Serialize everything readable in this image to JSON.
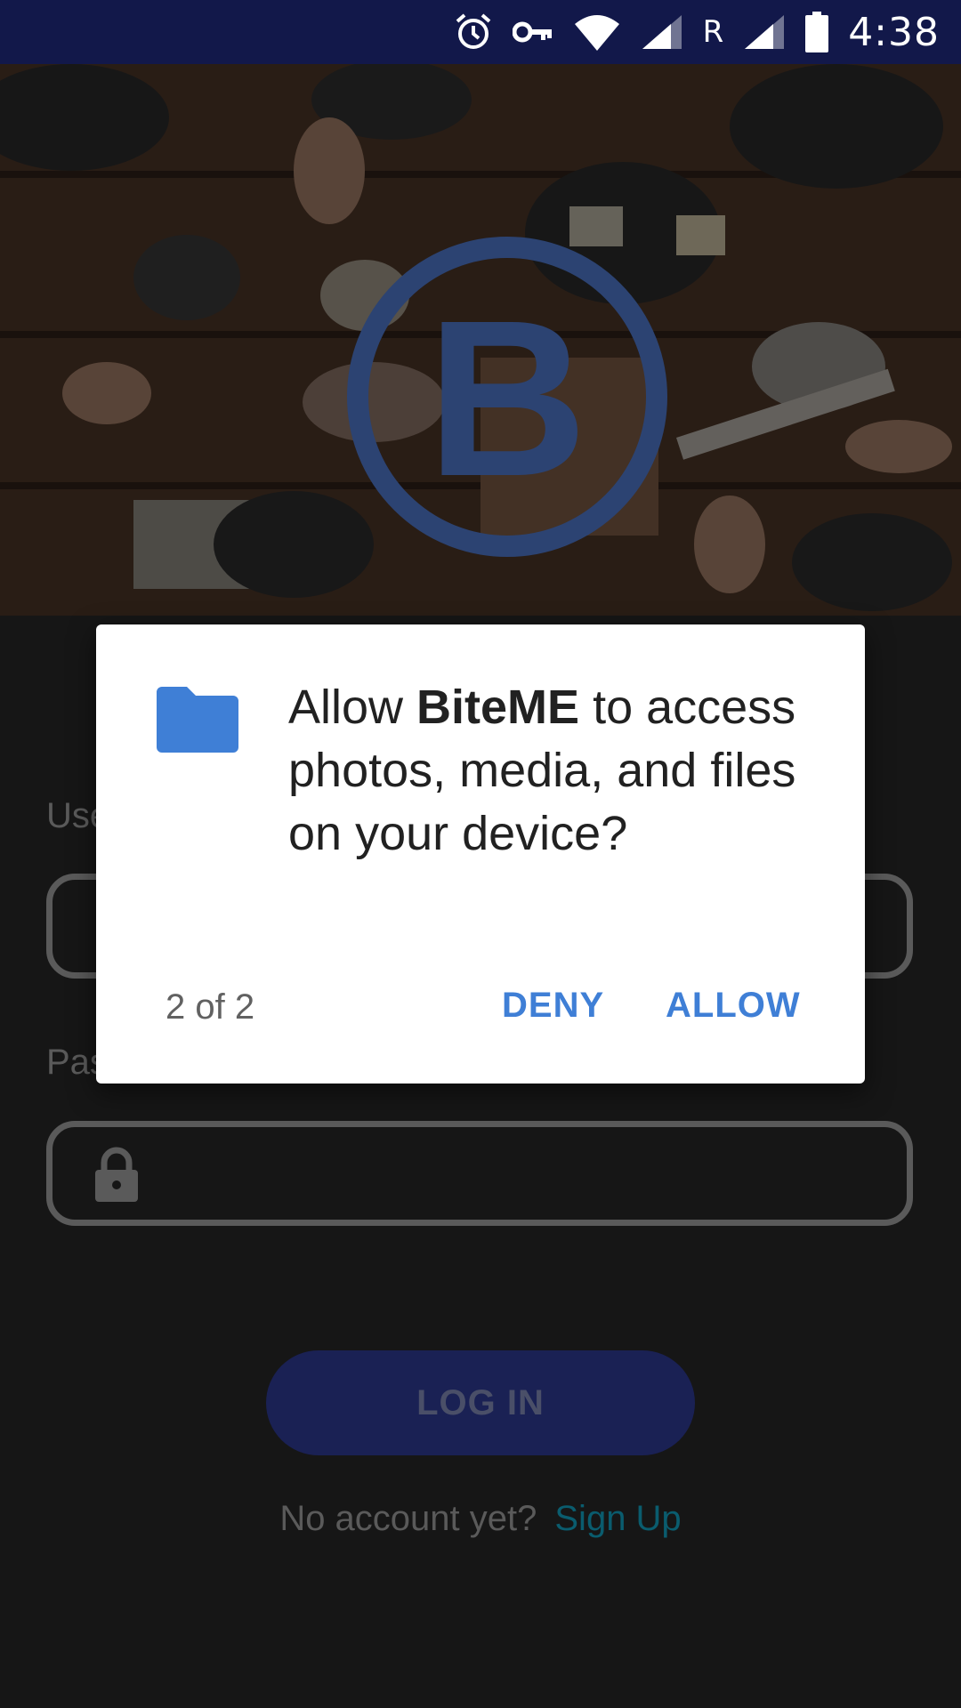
{
  "status_bar": {
    "carrier": "R",
    "time": "4:38",
    "icons": [
      "alarm-icon",
      "vpn-key-icon",
      "wifi-icon",
      "signal-icon",
      "signal-icon",
      "battery-icon"
    ]
  },
  "app": {
    "logo_letter": "B",
    "brand_color": "#2c4372"
  },
  "form": {
    "username_label": "Use",
    "password_label": "Pas",
    "login_label": "LOG IN",
    "signup_prompt": "No account yet?",
    "signup_link": "Sign Up"
  },
  "dialog": {
    "message_prefix": "Allow ",
    "app_name": "BiteME",
    "message_suffix": " to access photos, media, and files on your device?",
    "counter": "2 of 2",
    "deny_label": "DENY",
    "allow_label": "ALLOW",
    "icon": "folder-icon",
    "accent_color": "#3f7fd6"
  }
}
